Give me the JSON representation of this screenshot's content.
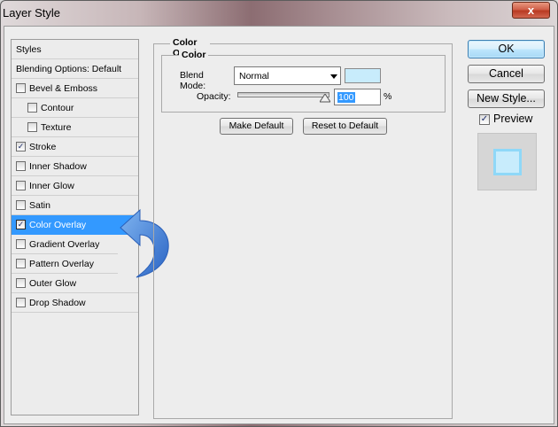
{
  "window": {
    "title": "Layer Style",
    "close_glyph": "x"
  },
  "styles_list": {
    "header": "Styles",
    "blending_options": "Blending Options: Default",
    "items": [
      {
        "label": "Bevel & Emboss",
        "checked": false
      },
      {
        "label": "Contour",
        "checked": false
      },
      {
        "label": "Texture",
        "checked": false
      },
      {
        "label": "Stroke",
        "checked": true
      },
      {
        "label": "Inner Shadow",
        "checked": false
      },
      {
        "label": "Inner Glow",
        "checked": false
      },
      {
        "label": "Satin",
        "checked": false
      },
      {
        "label": "Color Overlay",
        "checked": true,
        "selected": true
      },
      {
        "label": "Gradient Overlay",
        "checked": false
      },
      {
        "label": "Pattern Overlay",
        "checked": false
      },
      {
        "label": "Outer Glow",
        "checked": false
      },
      {
        "label": "Drop Shadow",
        "checked": false
      }
    ]
  },
  "panel": {
    "group_title": "Color Overlay",
    "subgroup_title": "Color",
    "blend_mode_label": "Blend Mode:",
    "blend_mode_value": "Normal",
    "overlay_color": "#c8ecfc",
    "opacity_label": "Opacity:",
    "opacity_value": "100",
    "opacity_unit": "%",
    "make_default": "Make Default",
    "reset_default": "Reset to Default"
  },
  "actions": {
    "ok": "OK",
    "cancel": "Cancel",
    "new_style": "New Style...",
    "preview_label": "Preview",
    "preview_checked": true
  },
  "annotation": {
    "icon": "curved-arrow-icon",
    "color": "#3a78d8"
  },
  "colors": {
    "selection": "#3399ff",
    "panel_bg": "#ededed"
  }
}
